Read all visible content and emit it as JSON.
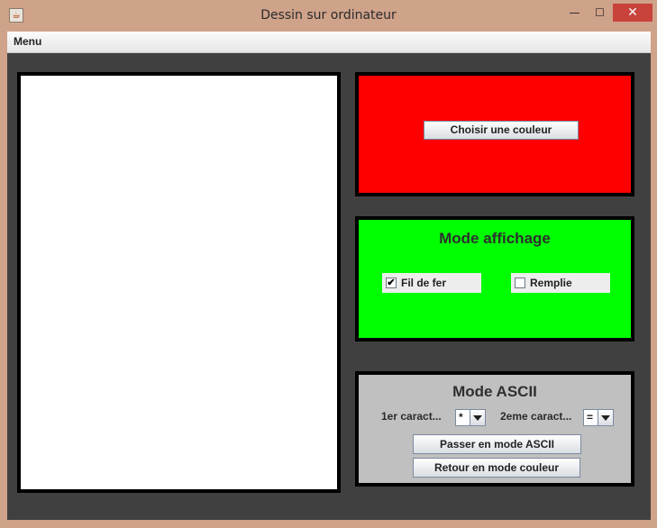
{
  "window": {
    "title": "Dessin sur ordinateur",
    "controls": {
      "minimize": "—",
      "maximize": "☐",
      "close": "✕"
    }
  },
  "menubar": {
    "menu_label": "Menu"
  },
  "color_panel": {
    "button_label": "Choisir une couleur",
    "background": "#ff0000"
  },
  "display_panel": {
    "title": "Mode affichage",
    "background": "#00ff00",
    "wireframe": {
      "label": "Fil de fer",
      "checked": true
    },
    "filled": {
      "label": "Remplie",
      "checked": false
    }
  },
  "ascii_panel": {
    "title": "Mode ASCII",
    "background": "#c0c0c0",
    "first_char_label": "1er caract...",
    "first_char_value": "*",
    "second_char_label": "2eme caract...",
    "second_char_value": "=",
    "ascii_button": "Passer en mode ASCII",
    "color_button": "Retour en mode couleur"
  }
}
